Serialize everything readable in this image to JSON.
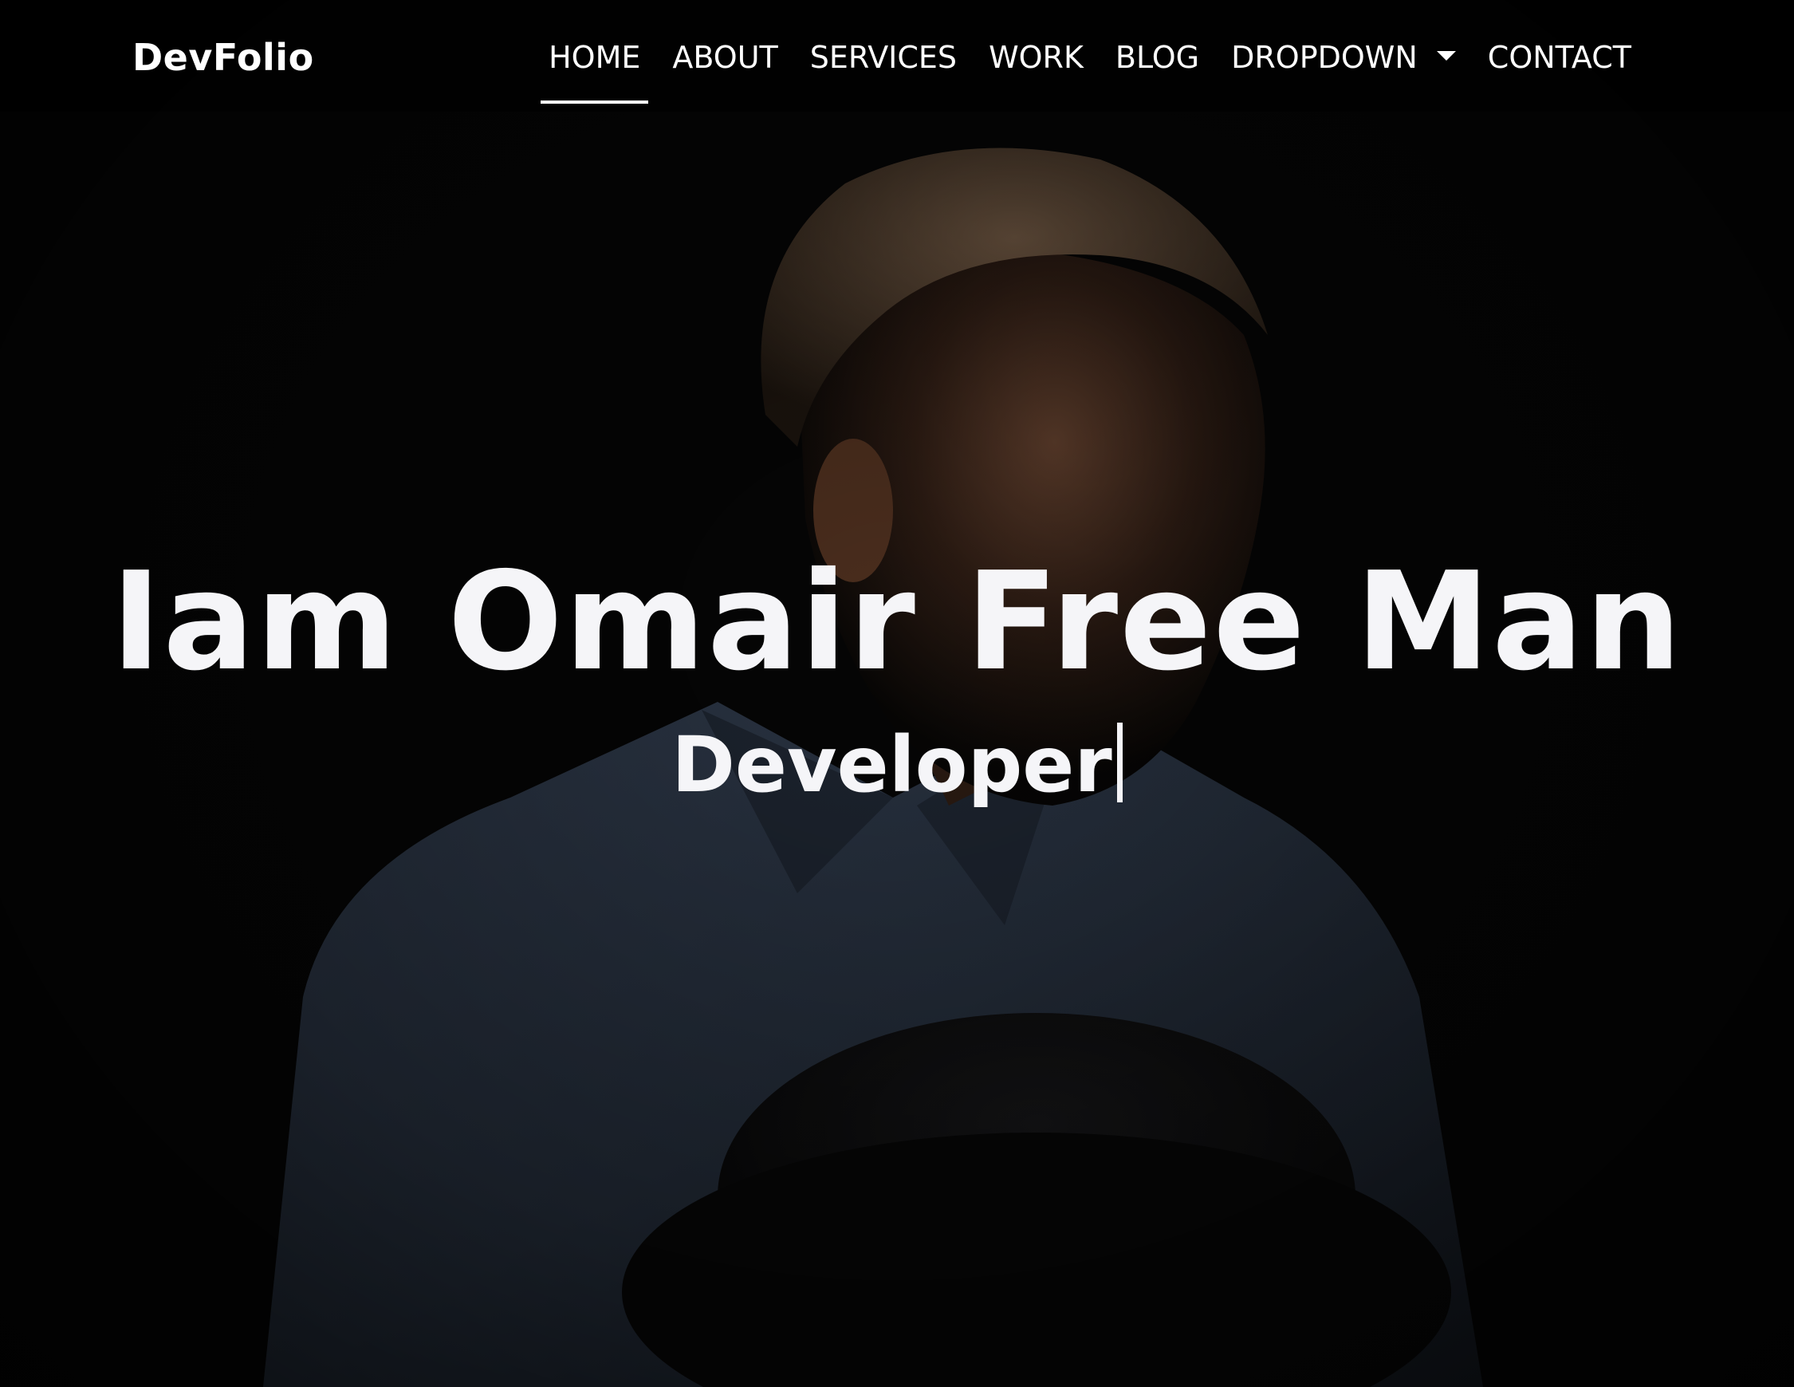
{
  "navbar": {
    "brand": "DevFolio",
    "items": [
      {
        "label": "HOME",
        "active": true
      },
      {
        "label": "ABOUT",
        "active": false
      },
      {
        "label": "SERVICES",
        "active": false
      },
      {
        "label": "WORK",
        "active": false
      },
      {
        "label": "BLOG",
        "active": false
      },
      {
        "label": "DROPDOWN",
        "active": false,
        "icon": "caret-down-icon"
      },
      {
        "label": "CONTACT",
        "active": false
      }
    ]
  },
  "hero": {
    "title": "Iam Omair Free Man",
    "subtitle": "Developer"
  },
  "colors": {
    "background": "#050505",
    "text": "#f5f5f8",
    "nav_text": "#ffffff"
  }
}
